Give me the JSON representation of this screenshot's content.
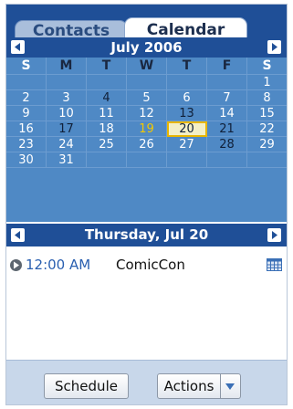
{
  "tabs": [
    {
      "label": "Contacts",
      "active": false
    },
    {
      "label": "Calendar",
      "active": true
    }
  ],
  "month": {
    "title": "July 2006",
    "weekday_headers": [
      "S",
      "M",
      "T",
      "W",
      "T",
      "F",
      "S"
    ],
    "weeks": [
      [
        "",
        "",
        "",
        "",
        "",
        "",
        "1"
      ],
      [
        "2",
        "3",
        "4",
        "5",
        "6",
        "7",
        "8"
      ],
      [
        "9",
        "10",
        "11",
        "12",
        "13",
        "14",
        "15"
      ],
      [
        "16",
        "17",
        "18",
        "19",
        "20",
        "21",
        "22"
      ],
      [
        "23",
        "24",
        "25",
        "26",
        "27",
        "28",
        "29"
      ],
      [
        "30",
        "31",
        "",
        "",
        "",
        "",
        ""
      ]
    ],
    "today": "19",
    "selected": "20"
  },
  "day": {
    "title": "Thursday, Jul 20"
  },
  "events": [
    {
      "time": "12:00 AM",
      "title": "ComicCon",
      "icon": "calendar-grid-icon"
    }
  ],
  "footer": {
    "schedule_label": "Schedule",
    "actions_label": "Actions"
  },
  "colors": {
    "header_blue": "#1f4f97",
    "grid_blue": "#4f89c5",
    "today_yellow": "#f4c800",
    "selected_bg": "#f3efc6",
    "footer_bg": "#c8d7ea"
  }
}
